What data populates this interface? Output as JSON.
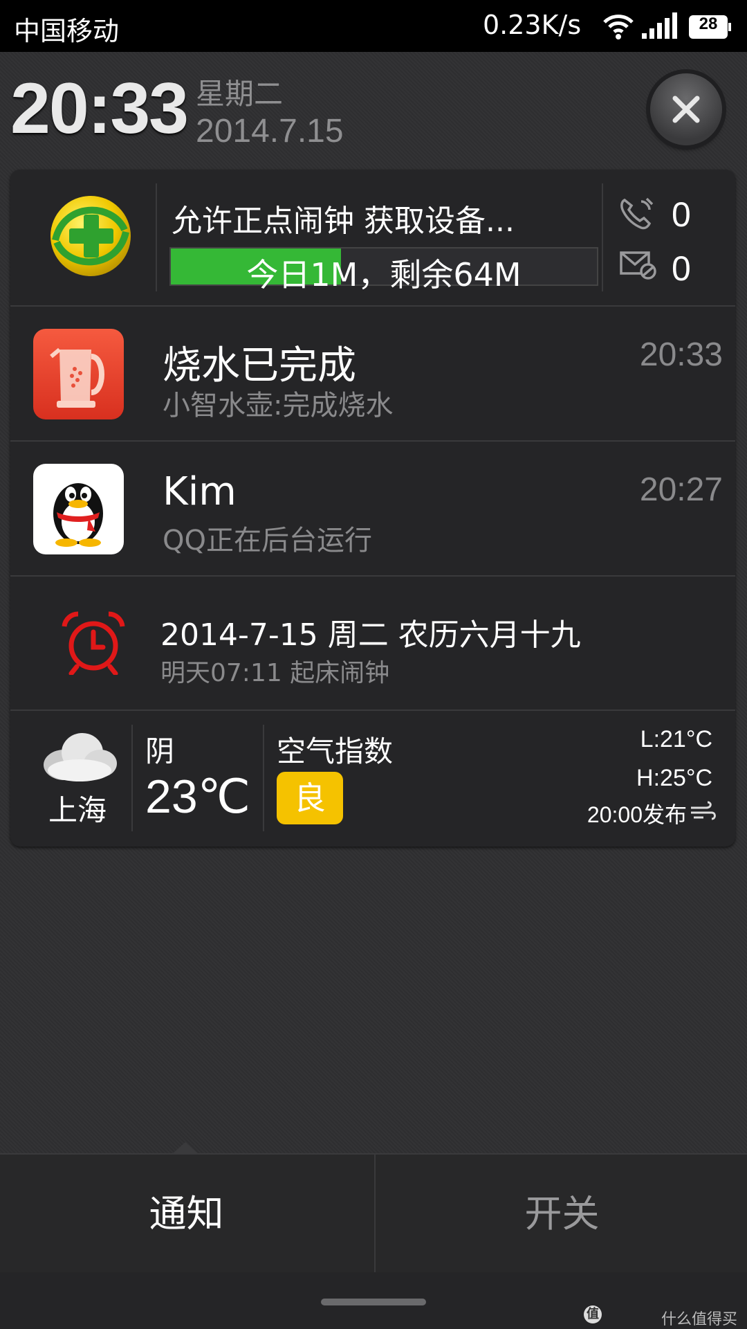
{
  "status_bar": {
    "carrier": "中国移动",
    "net_speed": "0.23K/s",
    "battery": "28",
    "icons": [
      "wifi-icon",
      "signal-icon",
      "battery-icon"
    ]
  },
  "header": {
    "time": "20:33",
    "weekday": "星期二",
    "date": "2014.7.15",
    "close_icon": "close-icon"
  },
  "traffic_widget": {
    "title": "允许正点闹钟 获取设备...",
    "usage_text": "今日1M，剩余64M",
    "used_fraction": 0.4,
    "calls": "0",
    "messages": "0",
    "colors": {
      "bar": "#35b836"
    }
  },
  "notifications": [
    {
      "title": "烧水已完成",
      "text": "小智水壶:完成烧水",
      "time": "20:33",
      "icon": "kettle-app-icon"
    },
    {
      "title": "Kim",
      "text": "QQ正在后台运行",
      "time": "20:27",
      "icon": "qq-penguin-icon"
    }
  ],
  "calendar": {
    "title": "2014-7-15 周二 农历六月十九",
    "alarm": "明天07:11 起床闹钟",
    "icon": "alarm-clock-icon"
  },
  "weather": {
    "city": "上海",
    "condition": "阴",
    "temperature": "23℃",
    "aqi_label": "空气指数",
    "aqi_value": "良",
    "low": "L:21°C",
    "high": "H:25°C",
    "published": "20:00发布",
    "colors": {
      "aqi_badge": "#f5c200"
    }
  },
  "tabs": {
    "notifications": "通知",
    "toggles": "开关"
  },
  "watermark": "什么值得买"
}
